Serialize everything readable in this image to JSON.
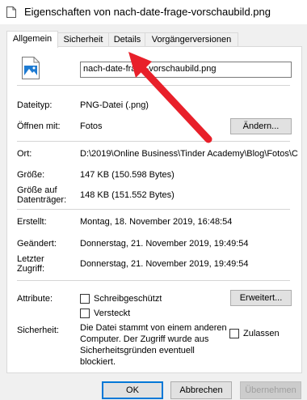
{
  "window": {
    "title": "Eigenschaften von nach-date-frage-vorschaubild.png"
  },
  "tabs": [
    "Allgemein",
    "Sicherheit",
    "Details",
    "Vorgängerversionen"
  ],
  "general": {
    "filename": "nach-date-frage-vorschaubild.png",
    "filetype_label": "Dateityp:",
    "filetype_value": "PNG-Datei (.png)",
    "openwith_label": "Öffnen mit:",
    "openwith_value": "Fotos",
    "change_button": "Ändern...",
    "location_label": "Ort:",
    "location_value": "D:\\2019\\Online Business\\Tinder Academy\\Blog\\Fotos\\C",
    "size_label": "Größe:",
    "size_value": "147 KB (150.598 Bytes)",
    "sizeondisk_label_1": "Größe auf",
    "sizeondisk_label_2": "Datenträger:",
    "sizeondisk_value": "148 KB (151.552 Bytes)",
    "created_label": "Erstellt:",
    "created_value": "Montag, 18. November 2019, 16:48:54",
    "modified_label": "Geändert:",
    "modified_value": "Donnerstag, 21. November 2019, 19:49:54",
    "accessed_label_1": "Letzter",
    "accessed_label_2": "Zugriff:",
    "accessed_value": "Donnerstag, 21. November 2019, 19:49:54",
    "attributes_label": "Attribute:",
    "readonly_label": "Schreibgeschützt",
    "hidden_label": "Versteckt",
    "advanced_button": "Erweitert...",
    "security_label": "Sicherheit:",
    "security_text": "Die Datei stammt von einem anderen Computer. Zugriff wurde aus Sicherheitsgründen eventuell blockiert.",
    "security_line_1": "Die Datei stammt von einem anderen",
    "security_line_2": "Computer. Der Zugriff wurde aus",
    "security_line_3": "Sicherheitsgründen eventuell",
    "security_line_4": "blockiert.",
    "unblock_label": "Zulassen"
  },
  "footer": {
    "ok": "OK",
    "cancel": "Abbrechen",
    "apply": "Übernehmen"
  },
  "colors": {
    "accent": "#0078d7",
    "annotation_arrow": "#e8202a"
  }
}
